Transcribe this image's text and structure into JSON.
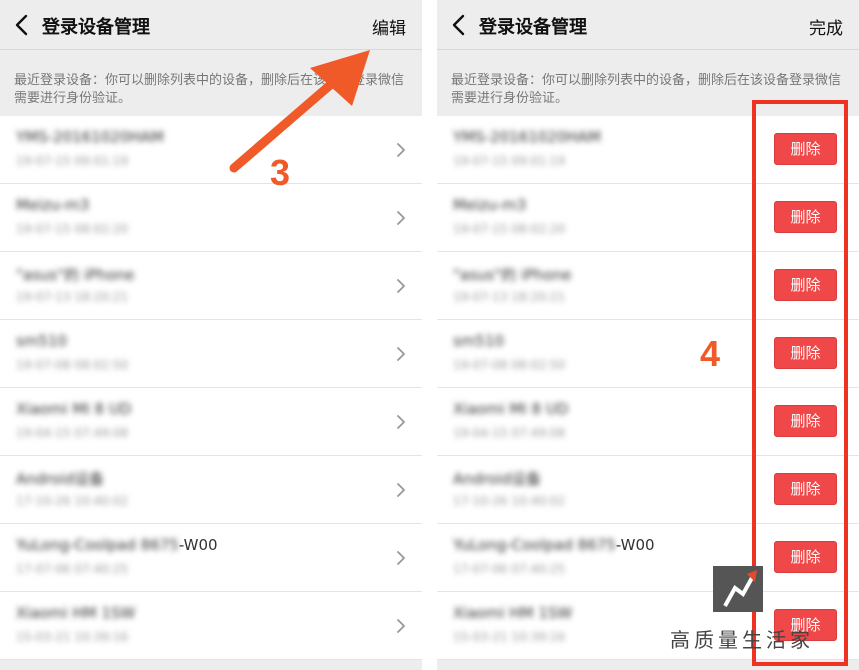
{
  "left_panel": {
    "title": "登录设备管理",
    "action": "编辑",
    "description": "最近登录设备：你可以删除列表中的设备，删除后在该设备登录微信需要进行身份验证。",
    "devices": [
      {
        "name": "YMS-20161020HAM",
        "date": "19-07-15 09:01:19"
      },
      {
        "name": "Meizu-m3",
        "date": "19-07-15 08:02:20"
      },
      {
        "name": "\"asus\"的 iPhone",
        "date": "19-07-13 18:20:21"
      },
      {
        "name": "sm510",
        "date": "19-07-08 08:02:50"
      },
      {
        "name": "Xiaomi MI 8 UD",
        "date": "19-04-15 07:49:08"
      },
      {
        "name": "Android设备",
        "date": "17-10-26 10:40:02"
      },
      {
        "name": "YuLong-Coolpad 8675",
        "name_clear": "-W00",
        "date": "17-07-06 07:40:25"
      },
      {
        "name": "Xiaomi HM 1SW",
        "date": "15-03-21 10:39:16"
      }
    ],
    "step_label": "3"
  },
  "right_panel": {
    "title": "登录设备管理",
    "action": "完成",
    "description": "最近登录设备：你可以删除列表中的设备，删除后在该设备登录微信需要进行身份验证。",
    "delete_label": "删除",
    "devices": [
      {
        "name": "YMS-20161020HAM",
        "date": "19-07-15 09:01:19"
      },
      {
        "name": "Meizu-m3",
        "date": "19-07-15 08:02:20"
      },
      {
        "name": "\"asus\"的 iPhone",
        "date": "19-07-13 18:20:21"
      },
      {
        "name": "sm510",
        "date": "19-07-08 08:02:50"
      },
      {
        "name": "Xiaomi MI 8 UD",
        "date": "19-04-15 07:49:08"
      },
      {
        "name": "Android设备",
        "date": "17-10-26 10:40:02"
      },
      {
        "name": "YuLong-Coolpad 8675",
        "name_clear": "-W00",
        "date": "17-07-06 07:40:25"
      },
      {
        "name": "Xiaomi HM 1SW",
        "date": "15-03-21 10:39:16"
      }
    ],
    "step_label": "4"
  },
  "watermark": {
    "text": "高质量生活家"
  },
  "colors": {
    "accent": "#f05a28",
    "delete": "#f04848",
    "frame": "#ee3322"
  }
}
